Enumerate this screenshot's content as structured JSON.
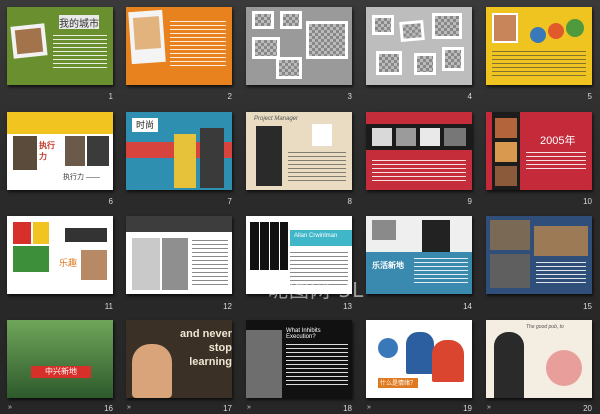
{
  "slides": [
    {
      "number": "1"
    },
    {
      "number": "2"
    },
    {
      "number": "3"
    },
    {
      "number": "4"
    },
    {
      "number": "5"
    },
    {
      "number": "6"
    },
    {
      "number": "7"
    },
    {
      "number": "8"
    },
    {
      "number": "9"
    },
    {
      "number": "10"
    },
    {
      "number": "11"
    },
    {
      "number": "12"
    },
    {
      "number": "13"
    },
    {
      "number": "14"
    },
    {
      "number": "15"
    },
    {
      "number": "16"
    },
    {
      "number": "17"
    },
    {
      "number": "18"
    },
    {
      "number": "19"
    },
    {
      "number": "20"
    }
  ],
  "slide_text": {
    "s1_title": "我的城市",
    "s6_left": "执行力",
    "s6_right": "执行力 ——",
    "s7_title": "时尚",
    "s8_title": "Project Manager",
    "s10_year": "2005年",
    "s11_label": "乐趣",
    "s13_title": "Allan Crwinlman",
    "s14_title": "乐活新地",
    "s16_title": "中兴新地",
    "s17_l1": "and never",
    "s17_l2": "stop",
    "s17_l3": "learning",
    "s18_title": "What Inhibits Execution?",
    "s19_label": "什么是情绪？",
    "s20_title": "The good pub, to"
  },
  "watermark": "昵图网 3L",
  "icons": {
    "slide_arrows": "transition-icon"
  }
}
